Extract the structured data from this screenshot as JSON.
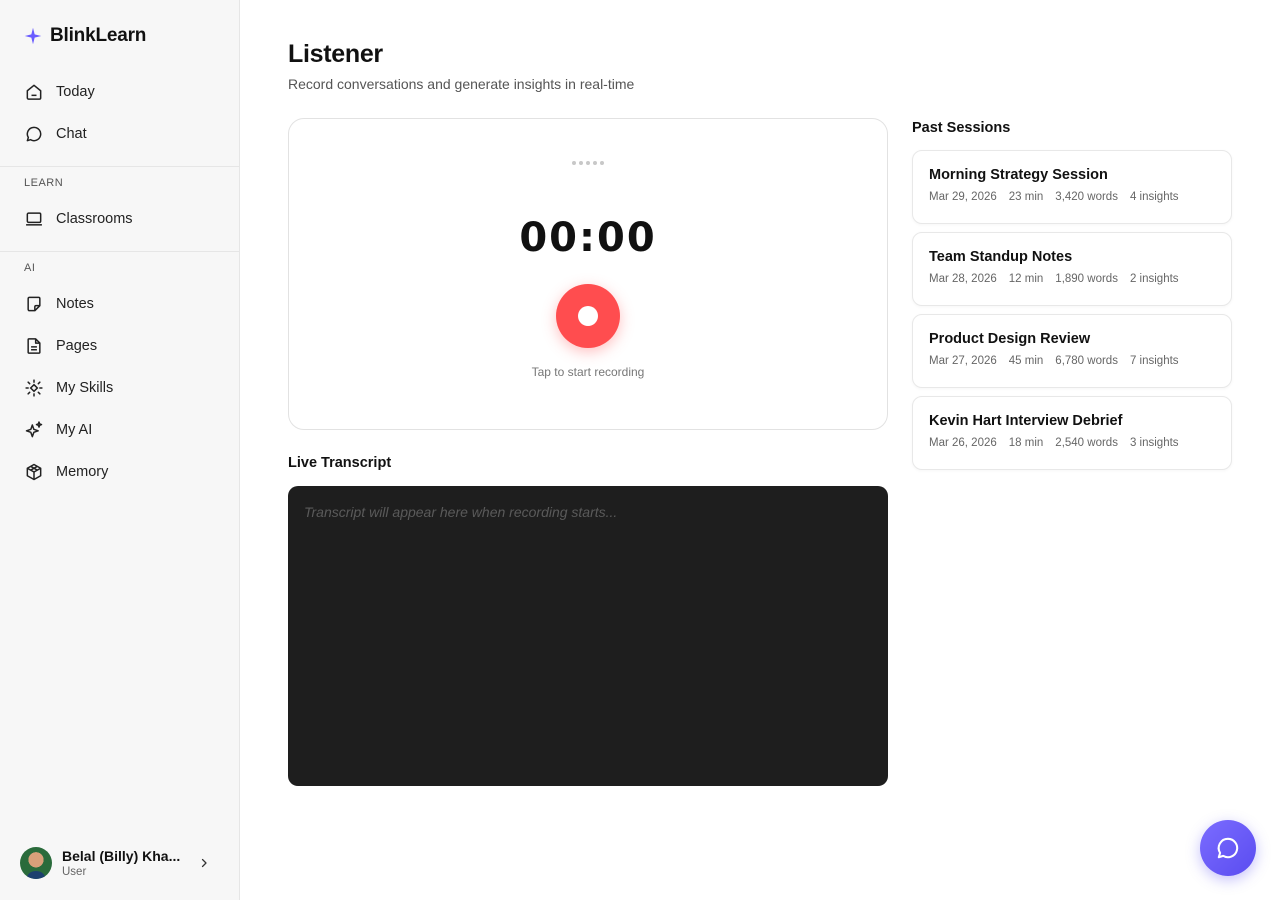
{
  "app": {
    "name": "BlinkLearn",
    "accent_color": "#6a5cff"
  },
  "sidebar": {
    "top_items": [
      {
        "label": "Today",
        "icon": "home-icon"
      },
      {
        "label": "Chat",
        "icon": "chat-bubble-icon"
      }
    ],
    "sections": [
      {
        "label": "LEARN",
        "items": [
          {
            "label": "Classrooms",
            "icon": "laptop-icon"
          }
        ]
      },
      {
        "label": "AI",
        "items": [
          {
            "label": "Notes",
            "icon": "note-icon"
          },
          {
            "label": "Pages",
            "icon": "document-icon"
          },
          {
            "label": "My Skills",
            "icon": "skills-icon"
          },
          {
            "label": "My AI",
            "icon": "sparkles-icon"
          },
          {
            "label": "Memory",
            "icon": "cube-icon"
          }
        ]
      }
    ],
    "user": {
      "name": "Belal (Billy) Kha...",
      "role": "User"
    }
  },
  "main": {
    "title": "Listener",
    "subtitle": "Record conversations and generate insights in real-time",
    "recorder": {
      "timer": "00:00",
      "hint": "Tap to start recording",
      "record_color": "#ff4d4f"
    },
    "transcript": {
      "title": "Live Transcript",
      "placeholder": "Transcript will appear here when recording starts..."
    },
    "past_sessions": {
      "title": "Past Sessions",
      "items": [
        {
          "title": "Morning Strategy Session",
          "date": "Mar 29, 2026",
          "duration": "23 min",
          "words": "3,420 words",
          "insights": "4 insights"
        },
        {
          "title": "Team Standup Notes",
          "date": "Mar 28, 2026",
          "duration": "12 min",
          "words": "1,890 words",
          "insights": "2 insights"
        },
        {
          "title": "Product Design Review",
          "date": "Mar 27, 2026",
          "duration": "45 min",
          "words": "6,780 words",
          "insights": "7 insights"
        },
        {
          "title": "Kevin Hart Interview Debrief",
          "date": "Mar 26, 2026",
          "duration": "18 min",
          "words": "2,540 words",
          "insights": "3 insights"
        }
      ]
    }
  },
  "fab": {
    "icon": "chat-bubble-icon"
  }
}
